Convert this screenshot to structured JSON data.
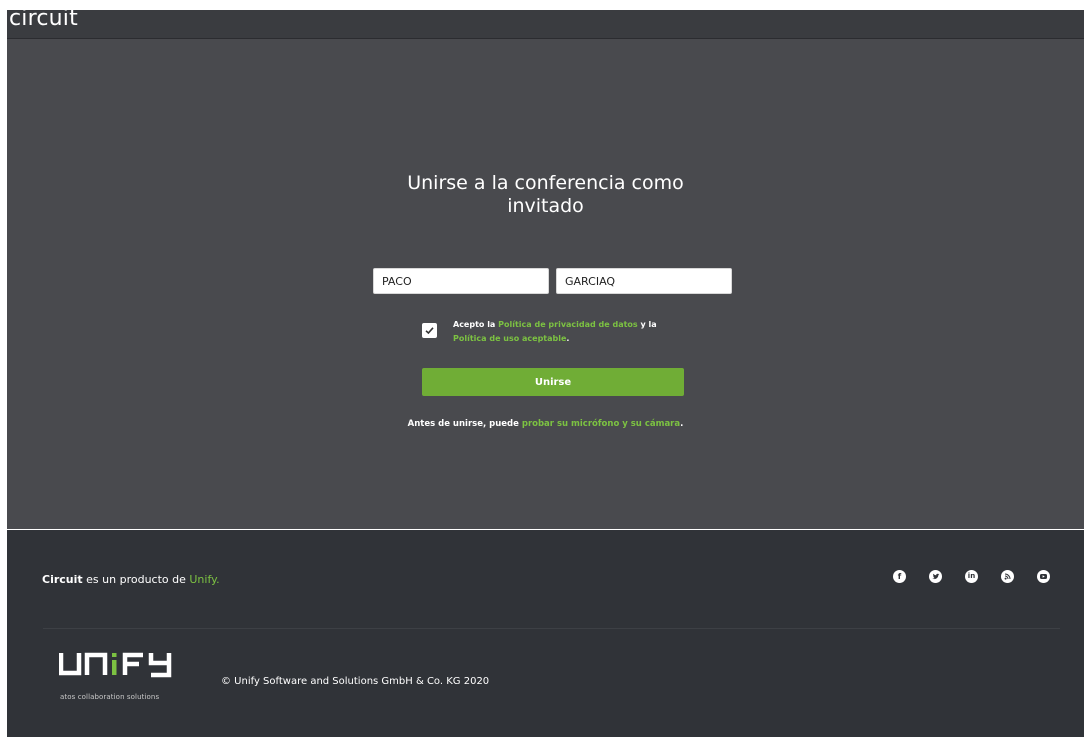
{
  "app": {
    "logo_text": "circuit"
  },
  "main": {
    "title_line1": "Unirse a la conferencia como",
    "title_line2": "invitado",
    "first_name_value": "PACO",
    "last_name_value": "GARCIAQ",
    "accept_checked": true,
    "terms": {
      "prefix": "Acepto la ",
      "privacy_link": "Política de privacidad de datos",
      "middle": " y la",
      "acceptable_use_link": "Política de uso aceptable",
      "suffix": "."
    },
    "join_label": "Unirse",
    "pretest": {
      "prefix": "Antes de unirse, puede ",
      "link": "probar su micrófono y su cámara",
      "suffix": "."
    }
  },
  "footer": {
    "brand": "Circuit",
    "product_text": " es un producto de ",
    "unify_link": "Unify.",
    "socials": [
      "facebook-icon",
      "twitter-icon",
      "linkedin-icon",
      "blog-icon",
      "youtube-icon"
    ],
    "unify_logo_text": "UNIFY",
    "unify_tagline": "atos collaboration solutions",
    "copyright": "© Unify Software and Solutions GmbH & Co. KG 2020"
  },
  "colors": {
    "accent_green": "#7cc242",
    "button_green": "#70ad36",
    "header_bg": "#3a3c40",
    "main_bg": "#494a4e",
    "footer_bg": "#303338"
  }
}
